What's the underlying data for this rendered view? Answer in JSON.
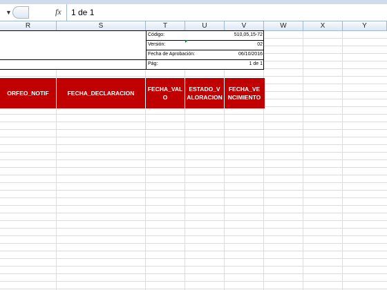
{
  "formula_bar": {
    "fx_label": "fx",
    "value": "1 de 1"
  },
  "columns": [
    "R",
    "S",
    "T",
    "U",
    "V",
    "W",
    "X",
    "Y"
  ],
  "info_block": {
    "codigo_label": "Código:",
    "codigo_value": "510,05,15-72",
    "version_label": "Versión:",
    "version_value": "02",
    "fecha_label": "Fecha de Aprobación:",
    "fecha_value": "06/10/2016",
    "pag_label": "Pág:",
    "pag_value": "1 de 1"
  },
  "headers": {
    "orfeo": "ORFEO_NOTIF",
    "fecha_declaracion": "FECHA_DECLARACION",
    "fecha_valo": "FECHA_VAL O",
    "estado_valoracion": "ESTADO_V ALORACION",
    "fecha_vencimiento": "FECHA_VE NCIMIENTO"
  },
  "colors": {
    "header_red": "#c00000",
    "grid": "#dadcdd",
    "ribbon": "#cfdcec"
  }
}
